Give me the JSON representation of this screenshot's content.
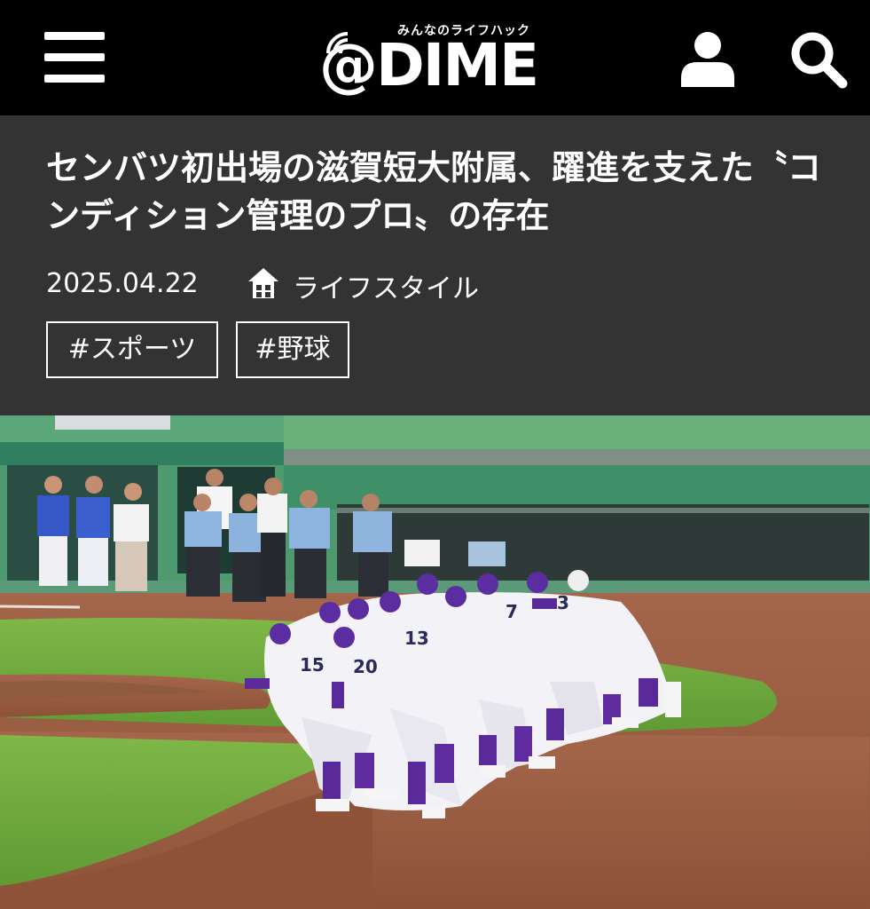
{
  "header": {
    "logo_tagline": "みんなのライフハック",
    "logo_text": "@DIME",
    "menu_icon": "hamburger-menu-icon",
    "user_icon": "user-icon",
    "search_icon": "search-icon",
    "background_color": "#000000"
  },
  "article": {
    "title": "センバツ初出場の滋賀短大附属、躍進を支えた〝コンディション管理のプロ〟の存在",
    "date": "2025.04.22",
    "category_icon": "house-icon",
    "category": "ライフスタイル",
    "tags": [
      "#スポーツ",
      "#野球"
    ],
    "header_background_color": "#333333"
  },
  "photo": {
    "image": "baseball-team-photo",
    "jersey_numbers": [
      "15",
      "20",
      "13",
      "7",
      "3"
    ]
  }
}
